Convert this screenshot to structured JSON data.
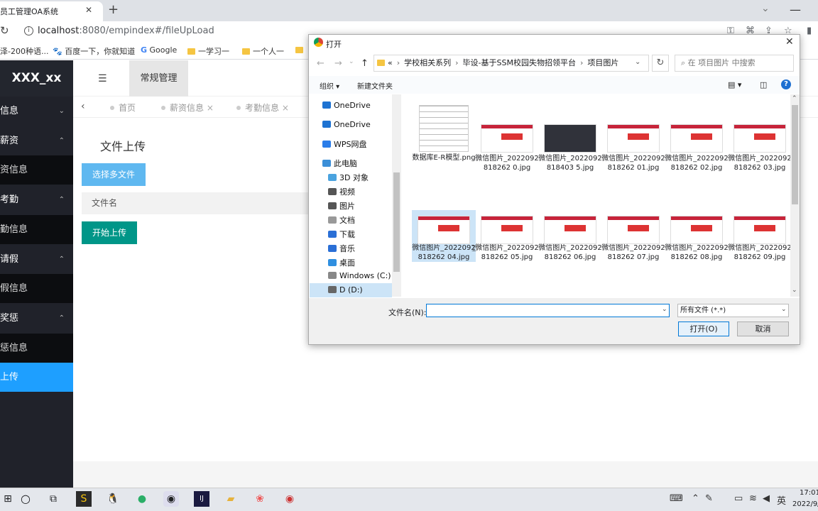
{
  "browser": {
    "tab_title": "员工管理OA系统",
    "url_host": "localhost",
    "url_path": ":8080/empindex#/fileUpLoad",
    "bookmarks": [
      "泽-200种语...",
      "百度一下，你就知道",
      "Google",
      "一学习一",
      "一个人一"
    ]
  },
  "app": {
    "logo": "XXX_xx",
    "sidebar": [
      {
        "label": "信息",
        "chev": "⌄",
        "sub": false
      },
      {
        "label": "薪资",
        "chev": "⌃",
        "sub": false
      },
      {
        "label": "资信息",
        "chev": "",
        "sub": true
      },
      {
        "label": "考勤",
        "chev": "⌃",
        "sub": false
      },
      {
        "label": "勤信息",
        "chev": "",
        "sub": true
      },
      {
        "label": "请假",
        "chev": "⌃",
        "sub": false
      },
      {
        "label": "假信息",
        "chev": "",
        "sub": true
      },
      {
        "label": "奖惩",
        "chev": "⌃",
        "sub": false
      },
      {
        "label": "惩信息",
        "chev": "",
        "sub": true
      },
      {
        "label": "上传",
        "chev": "",
        "sub": false,
        "active": true
      }
    ],
    "header_tab": "常规管理",
    "page_tabs": [
      "首页",
      "薪资信息",
      "考勤信息"
    ],
    "page_title": "文件上传",
    "select_button": "选择多文件",
    "column_filename": "文件名",
    "upload_button": "开始上传"
  },
  "dialog": {
    "title": "打开",
    "breadcrumb": [
      "«",
      "学校相关系列",
      "毕设-基于SSM校园失物招领平台",
      "项目图片"
    ],
    "search_placeholder": "在 项目图片 中搜索",
    "organize": "组织 ▾",
    "new_folder": "新建文件夹",
    "tree": [
      {
        "label": "OneDrive",
        "indent": 0,
        "color": "#1e73d2"
      },
      {
        "label": "OneDrive",
        "indent": 0,
        "color": "#1e73d2"
      },
      {
        "label": "WPS网盘",
        "indent": 0,
        "color": "#2b7de9"
      },
      {
        "label": "此电脑",
        "indent": 0,
        "color": "#3c8fd8"
      },
      {
        "label": "3D 对象",
        "indent": 1,
        "color": "#4aa3df"
      },
      {
        "label": "视频",
        "indent": 1,
        "color": "#555"
      },
      {
        "label": "图片",
        "indent": 1,
        "color": "#555"
      },
      {
        "label": "文档",
        "indent": 1,
        "color": "#999"
      },
      {
        "label": "下载",
        "indent": 1,
        "color": "#2a6fd6"
      },
      {
        "label": "音乐",
        "indent": 1,
        "color": "#2a6fd6"
      },
      {
        "label": "桌面",
        "indent": 1,
        "color": "#2f8fe0"
      },
      {
        "label": "Windows  (C:)",
        "indent": 1,
        "color": "#888"
      },
      {
        "label": "D (D:)",
        "indent": 1,
        "color": "#666",
        "selected": true
      }
    ],
    "files": [
      {
        "name": "数据库E-R模型.png",
        "kind": "er"
      },
      {
        "name": "微信图片_2022092818262 0.jpg",
        "kind": "web"
      },
      {
        "name": "微信图片_2022092818403 5.jpg",
        "kind": "dark"
      },
      {
        "name": "微信图片_2022092818262 01.jpg",
        "kind": "web"
      },
      {
        "name": "微信图片_2022092818262 02.jpg",
        "kind": "web"
      },
      {
        "name": "微信图片_2022092818262 03.jpg",
        "kind": "web"
      },
      {
        "name": "微信图片_2022092818262 04.jpg",
        "kind": "web",
        "selected": true
      },
      {
        "name": "微信图片_2022092818262 05.jpg",
        "kind": "web"
      },
      {
        "name": "微信图片_2022092818262 06.jpg",
        "kind": "web"
      },
      {
        "name": "微信图片_2022092818262 07.jpg",
        "kind": "web"
      },
      {
        "name": "微信图片_2022092818262 08.jpg",
        "kind": "web"
      },
      {
        "name": "微信图片_2022092818262 09.jpg",
        "kind": "web"
      }
    ],
    "filename_label": "文件名(N):",
    "filter": "所有文件 (*.*)",
    "open_button": "打开(O)",
    "cancel_button": "取消"
  },
  "taskbar": {
    "time": "17:01",
    "date": "2022/9/",
    "ime": "英"
  },
  "colors": {
    "sidebar": "#20222a",
    "accent": "#1e9fff",
    "upload": "#009688"
  }
}
